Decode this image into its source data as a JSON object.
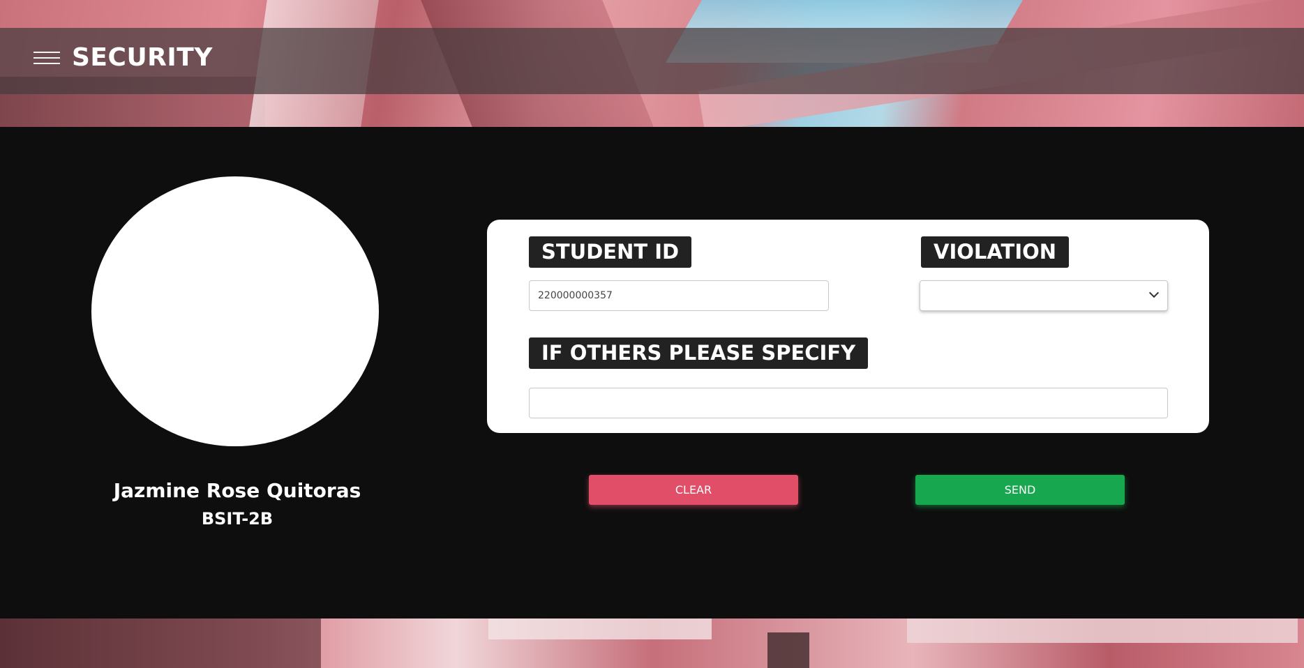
{
  "header": {
    "title": "SECURITY",
    "menu_icon": "hamburger-menu-icon"
  },
  "student": {
    "name": "Jazmine Rose Quitoras",
    "section": "BSIT-2B"
  },
  "form": {
    "student_id_label": "STUDENT ID",
    "student_id_value": "220000000357",
    "violation_label": "VIOLATION",
    "violation_value": "",
    "others_label": "IF OTHERS PLEASE SPECIFY",
    "others_value": ""
  },
  "buttons": {
    "clear_label": "CLEAR",
    "send_label": "SEND"
  },
  "colors": {
    "clear": "#e04e67",
    "send": "#17a74f",
    "label_chip": "#222222",
    "background": "#0e0e0e"
  }
}
